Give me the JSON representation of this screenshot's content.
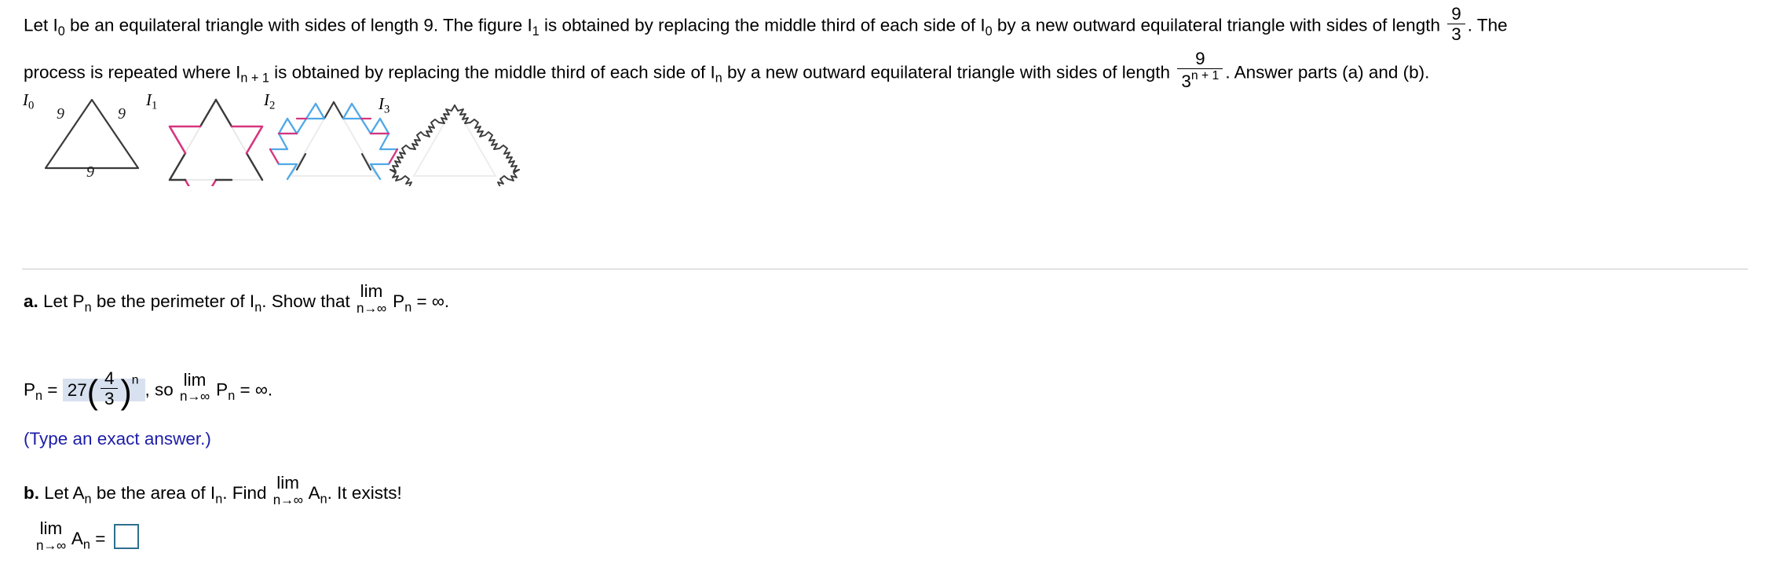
{
  "statement": {
    "line1_a": "Let I",
    "line1_a_sub": "0",
    "line1_b": " be an equilateral triangle with sides of length 9. The figure I",
    "line1_b_sub": "1",
    "line1_c": " is obtained by replacing the middle third of each side of I",
    "line1_c_sub": "0",
    "line1_d": " by a new outward equilateral triangle with sides of length ",
    "frac1_num": "9",
    "frac1_den": "3",
    "line1_e": ". The",
    "line2_a": "process is repeated where I",
    "line2_a_sub": "n + 1",
    "line2_b": " is obtained by replacing the middle third of each side of I",
    "line2_b_sub": "n",
    "line2_c": " by a new outward equilateral triangle with sides of length ",
    "frac2_num": "9",
    "frac2_den_base": "3",
    "frac2_den_exp": "n + 1",
    "line2_d": ". Answer parts (a) and (b)."
  },
  "figures": [
    {
      "label": "I",
      "sub": "0",
      "side_labels": [
        "9",
        "9",
        "9"
      ]
    },
    {
      "label": "I",
      "sub": "1",
      "side_labels": []
    },
    {
      "label": "I",
      "sub": "2",
      "side_labels": []
    },
    {
      "label": "I",
      "sub": "3",
      "side_labels": []
    }
  ],
  "figure_colors": {
    "base_triangle": "#3a3a3a",
    "iteration1": "#d6357f",
    "iteration2": "#4fa8e8",
    "faded_guide": "#e8e8e8"
  },
  "part_a": {
    "marker": "a.",
    "text_1": " Let P",
    "sub_1": "n",
    "text_2": " be the perimeter of I",
    "sub_2": "n",
    "text_3": ". Show that ",
    "lim_top": "lim",
    "lim_bot": "n→∞",
    "text_4": " P",
    "sub_3": "n",
    "text_5": " = ∞."
  },
  "answer_a": {
    "lhs": "P",
    "lhs_sub": "n",
    "equals": " = ",
    "coefficient": "27",
    "frac_num": "4",
    "frac_den": "3",
    "exponent": "n",
    "comma_so": ", so ",
    "lim_top": "lim",
    "lim_bot": "n→∞",
    "tail": " P",
    "tail_sub": "n",
    "tail_end": " = ∞.",
    "highlight_color": "#d8e1ef"
  },
  "hint_a": {
    "text": "(Type an exact answer.)",
    "color": "#1d1da8"
  },
  "part_b": {
    "marker": "b.",
    "text_1": " Let A",
    "sub_1": "n",
    "text_2": " be the area of I",
    "sub_2": "n",
    "text_3": ". Find ",
    "lim_top": "lim",
    "lim_bot": "n→∞",
    "text_4": " A",
    "sub_3": "n",
    "text_5": ". It exists!"
  },
  "answer_b": {
    "lim_top": "lim",
    "lim_bot": "n→∞",
    "label": " A",
    "label_sub": "n",
    "equals": " = ",
    "input_value": "",
    "input_border_color": "#2e6f8e"
  }
}
